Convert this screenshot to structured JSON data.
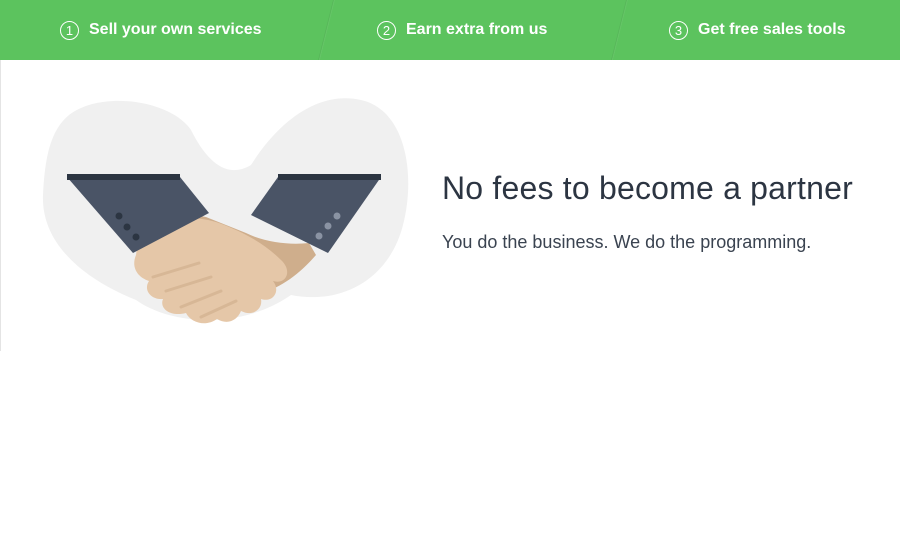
{
  "steps": [
    {
      "number": "1",
      "label": "Sell your own services"
    },
    {
      "number": "2",
      "label": "Earn extra from us"
    },
    {
      "number": "3",
      "label": "Get free sales tools"
    }
  ],
  "main": {
    "headline": "No fees to become a partner",
    "subline": "You do the business. We do the programming.",
    "illustration_icon": "handshake-icon"
  },
  "colors": {
    "accent_green": "#5cc35e",
    "sleeve": "#4a5466",
    "skin_light": "#e5c7a8",
    "skin_dark": "#cfae8c",
    "blob": "#f0f0f0",
    "text_dark": "#2c3542"
  }
}
